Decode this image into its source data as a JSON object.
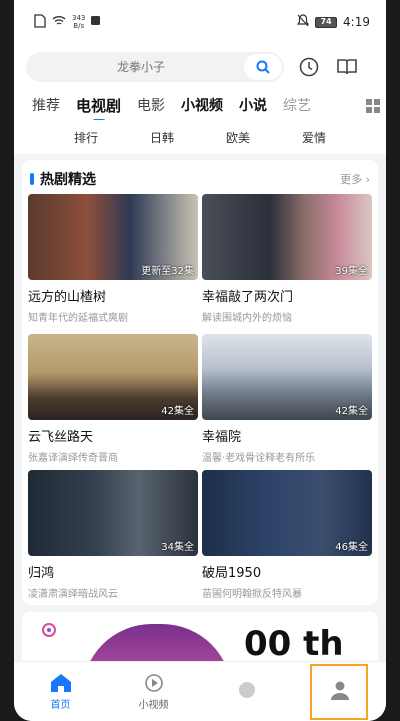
{
  "status_bar": {
    "net_speed_top": "343",
    "net_speed_bottom": "B/s",
    "battery": "74",
    "time": "4:19"
  },
  "search": {
    "placeholder": "龙拳小子"
  },
  "tabs": [
    {
      "label": "推荐"
    },
    {
      "label": "电视剧"
    },
    {
      "label": "电影"
    },
    {
      "label": "小视频"
    },
    {
      "label": "小说"
    },
    {
      "label": "综艺"
    }
  ],
  "categories": [
    "排行",
    "日韩",
    "欧美",
    "爱情"
  ],
  "section": {
    "title": "热剧精选",
    "more": "更多 ›"
  },
  "dramas": [
    {
      "title": "远方的山楂树",
      "subtitle": "知青年代的延福式爽剧",
      "badge": "更新至32集"
    },
    {
      "title": "幸福敲了两次门",
      "subtitle": "解读围城内外的烦恼",
      "badge": "39集全"
    },
    {
      "title": "云飞丝路天",
      "subtitle": "张嘉译演绎传奇晋商",
      "badge": "42集全"
    },
    {
      "title": "幸福院",
      "subtitle": "温馨·老戏骨诠释老有所乐",
      "badge": "42集全"
    },
    {
      "title": "归鸿",
      "subtitle": "凌潇肃演绎暗战风云",
      "badge": "34集全"
    },
    {
      "title": "破局1950",
      "subtitle": "苗圃何明翰掀反特风暴",
      "badge": "46集全"
    }
  ],
  "promo": {
    "text": "00 th"
  },
  "nav": [
    {
      "label": "首页",
      "icon": "home-icon"
    },
    {
      "label": "小视频",
      "icon": "video-icon"
    },
    {
      "label": "",
      "icon": "center-icon"
    },
    {
      "label": "",
      "icon": "profile-icon"
    }
  ],
  "colors": {
    "accent": "#1677ff",
    "highlight_frame": "#f5a623"
  }
}
